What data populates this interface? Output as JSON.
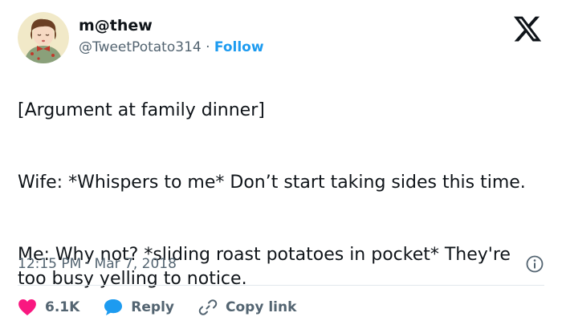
{
  "author": {
    "display_name": "m@thew",
    "handle": "@TweetPotato314",
    "separator": " · ",
    "follow_label": "Follow"
  },
  "tweet": {
    "paragraphs": [
      "[Argument at family dinner]",
      "Wife: *Whispers to me* Don’t start taking sides this time.",
      "Me: Why not? *sliding roast potatoes in pocket* They're too busy yelling to notice."
    ],
    "timestamp": "12:15 PM · Mar 7, 2018"
  },
  "actions": {
    "likes": "6.1K",
    "reply_label": "Reply",
    "copy_label": "Copy link"
  },
  "icons": {
    "logo": "x-logo-icon",
    "like": "heart-icon",
    "reply": "speech-bubble-icon",
    "copy": "link-icon",
    "info": "info-icon"
  },
  "colors": {
    "text": "#0f1419",
    "secondary": "#536471",
    "accent": "#1d9bf0",
    "like": "#f91880",
    "divider": "#e1e8ed"
  }
}
